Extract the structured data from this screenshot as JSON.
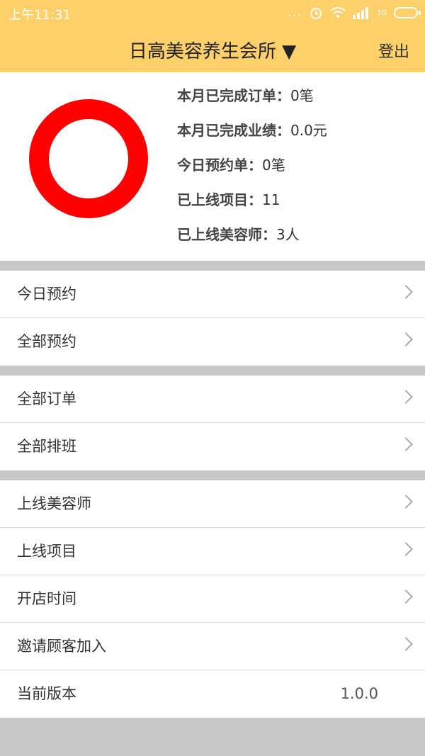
{
  "status_bar": {
    "time": "上午11:31",
    "more": "...",
    "network": "3G"
  },
  "header": {
    "title": "日高美容养生会所 ▼",
    "logout": "登出"
  },
  "summary": {
    "ring_color": "#ff0000",
    "stats": [
      {
        "label": "本月已完成订单：",
        "value": "0笔"
      },
      {
        "label": "本月已完成业绩：",
        "value": "0.0元"
      },
      {
        "label": "今日预约单：",
        "value": "0笔"
      },
      {
        "label": "已上线项目：",
        "value": "11"
      },
      {
        "label": "已上线美容师：",
        "value": "3人"
      }
    ]
  },
  "menu": {
    "today_appointments": "今日预约",
    "all_appointments": "全部预约",
    "all_orders": "全部订单",
    "all_schedules": "全部排班",
    "online_beauticians": "上线美容师",
    "online_projects": "上线项目",
    "opening_hours": "开店时间",
    "invite_customers": "邀请顾客加入",
    "current_version": "当前版本",
    "version_value": "1.0.0"
  },
  "colors": {
    "header_bg": "#fdd06a",
    "separator": "#c8c8c8"
  }
}
